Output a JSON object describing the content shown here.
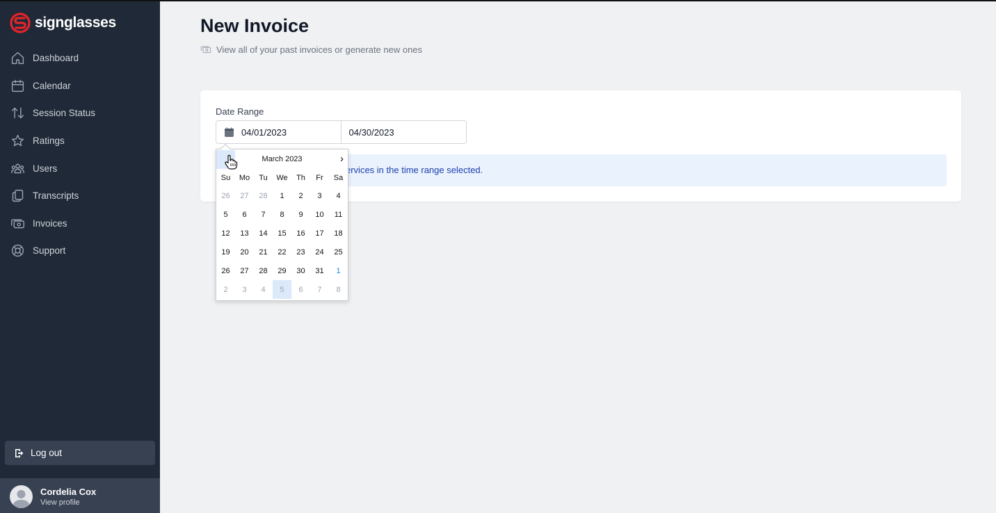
{
  "brand": {
    "name": "signglasses",
    "accent": "#e5242b"
  },
  "sidebar": {
    "items": [
      {
        "label": "Dashboard",
        "icon": "home-icon"
      },
      {
        "label": "Calendar",
        "icon": "calendar-icon"
      },
      {
        "label": "Session Status",
        "icon": "arrows-up-down-icon"
      },
      {
        "label": "Ratings",
        "icon": "star-icon"
      },
      {
        "label": "Users",
        "icon": "users-icon"
      },
      {
        "label": "Transcripts",
        "icon": "documents-icon"
      },
      {
        "label": "Invoices",
        "icon": "cash-icon"
      },
      {
        "label": "Support",
        "icon": "lifebuoy-icon"
      }
    ],
    "logout_label": "Log out",
    "profile": {
      "name": "Cordelia Cox",
      "link": "View profile"
    }
  },
  "page": {
    "title": "New Invoice",
    "subtitle": "View all of your past invoices or generate new ones"
  },
  "form": {
    "date_range_label": "Date Range",
    "start_date": "04/01/2023",
    "end_date": "04/30/2023",
    "info_text": "ervices in the time range selected."
  },
  "datepicker": {
    "month_label": "March 2023",
    "next_glyph": "›",
    "weekdays": [
      "Su",
      "Mo",
      "Tu",
      "We",
      "Th",
      "Fr",
      "Sa"
    ],
    "weeks": [
      [
        "26",
        "27",
        "28",
        "1",
        "2",
        "3",
        "4"
      ],
      [
        "5",
        "6",
        "7",
        "8",
        "9",
        "10",
        "11"
      ],
      [
        "12",
        "13",
        "14",
        "15",
        "16",
        "17",
        "18"
      ],
      [
        "19",
        "20",
        "21",
        "22",
        "23",
        "24",
        "25"
      ],
      [
        "26",
        "27",
        "28",
        "29",
        "30",
        "31",
        "1"
      ],
      [
        "2",
        "3",
        "4",
        "5",
        "6",
        "7",
        "8"
      ]
    ]
  }
}
